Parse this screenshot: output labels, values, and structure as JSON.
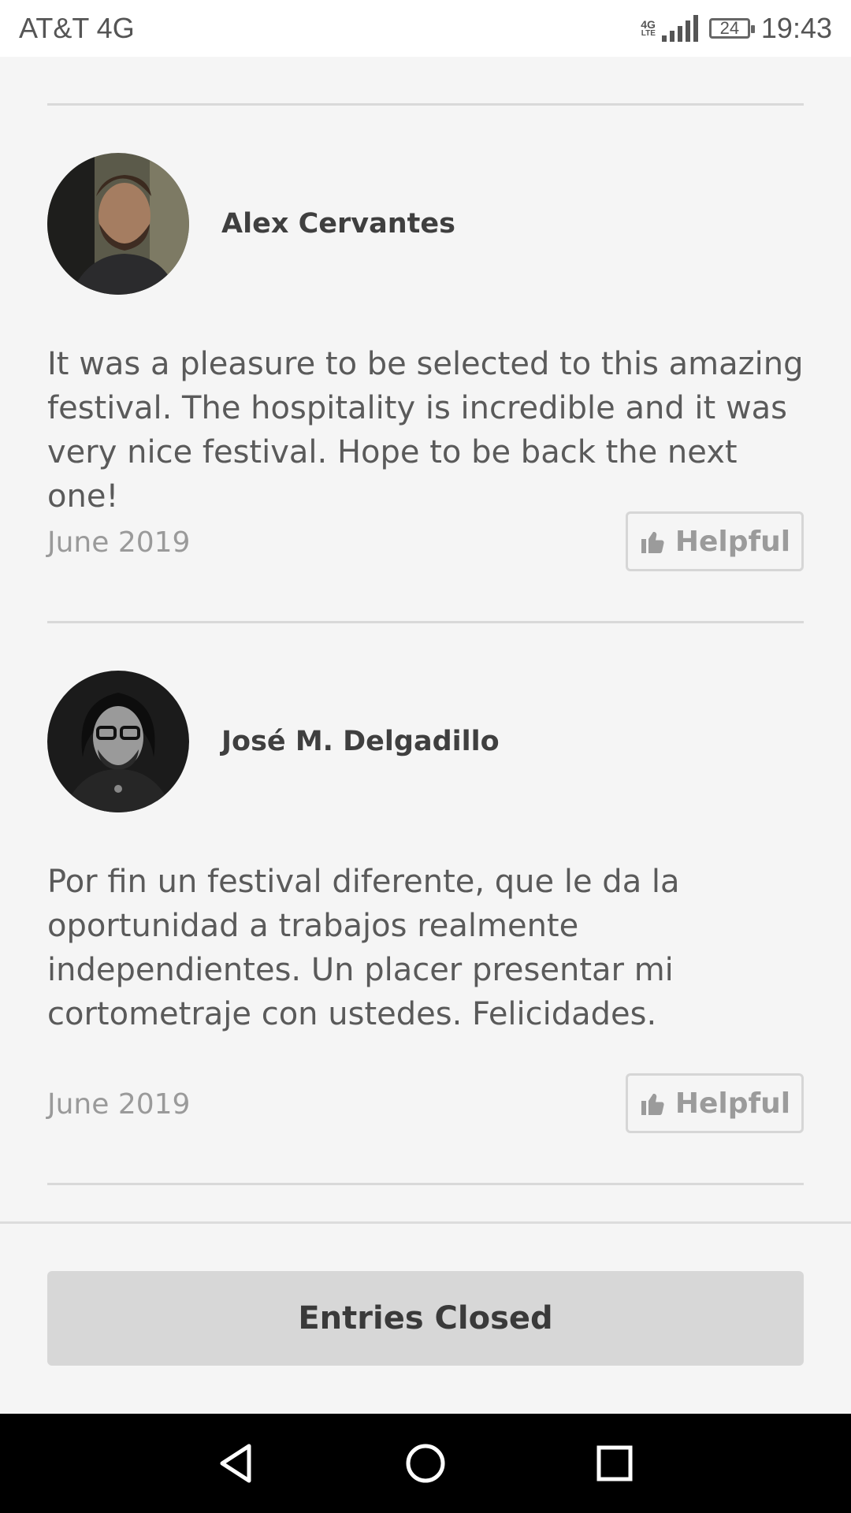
{
  "status_bar": {
    "carrier": "AT&T 4G",
    "network_tag": "4G",
    "network_sub": "LTE",
    "battery": "24",
    "time": "19:43"
  },
  "reviews": [
    {
      "name": "Alex Cervantes",
      "text": "It was a pleasure to be selected to this amazing festival. The hospitality is incredible and it was very nice festival. Hope to be back the next one!",
      "date": "June 2019",
      "helpful_label": "Helpful"
    },
    {
      "name": "José M. Delgadillo",
      "text": "Por fin un festival diferente, que le da la oportunidad a trabajos realmente independientes. Un placer presentar mi cortometraje con ustedes. Felicidades.",
      "date": "June 2019",
      "helpful_label": "Helpful"
    }
  ],
  "footer": {
    "button_label": "Entries Closed"
  },
  "icons": {
    "helpful": "thumbs-up-icon",
    "nav_back": "back-triangle-icon",
    "nav_home": "home-circle-icon",
    "nav_recent": "recent-square-icon"
  }
}
